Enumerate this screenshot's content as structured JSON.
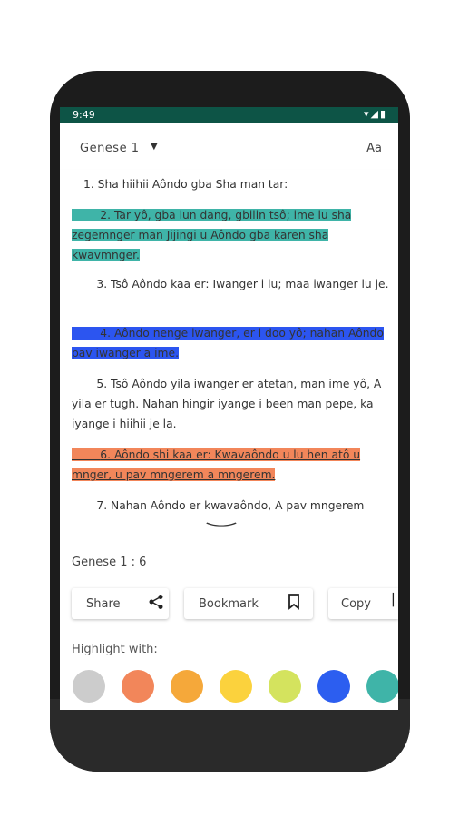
{
  "status": {
    "time": "9:49"
  },
  "header": {
    "book": "Genese 1",
    "font_button": "Aa"
  },
  "verses": [
    {
      "num": "1.",
      "text": "Sha hiihii Aôndo gba Sha man tar:",
      "highlight": "none"
    },
    {
      "num": "2.",
      "text": "Tar yô, gba lun dang, gbilin tsô; ime lu sha zegemnger man Jijingi u Aôndo gba karen sha kwavmnger.",
      "highlight": "#3fb4a8"
    },
    {
      "num": "3.",
      "text": "Tsô Aôndo kaa er: Iwanger i lu; maa iwanger lu je.",
      "highlight": "none"
    },
    {
      "num": "4.",
      "text": "Aôndo nenge iwanger, er i doo yô; nahan Aôndo pav iwanger a ime.",
      "highlight": "#2c55f0"
    },
    {
      "num": "5.",
      "text": "Tsô Aôndo yila iwanger er atetan, man ime yô, A yila er tugh. Nahan hingir iyange i been man pepe, ka iyange i hiihii je la.",
      "highlight": "none"
    },
    {
      "num": "6.",
      "text": "Aôndo shi kaa er: Kwavaôndo u lu hen atô u mnger, u pav mngerem a mngerem.",
      "highlight": "#f2865a"
    },
    {
      "num": "7.",
      "text": "Nahan Aôndo er kwavaôndo, A pav mngerem",
      "highlight": "none"
    }
  ],
  "selection": {
    "reference": "Genese 1 : 6"
  },
  "actions": {
    "share": "Share",
    "bookmark": "Bookmark",
    "copy": "Copy"
  },
  "highlight_panel": {
    "title": "Highlight with:",
    "colors": [
      "#cccccc",
      "#f2865a",
      "#f5a83a",
      "#fbd23d",
      "#d4e35e",
      "#2c5ef0",
      "#3fb4a8"
    ]
  }
}
